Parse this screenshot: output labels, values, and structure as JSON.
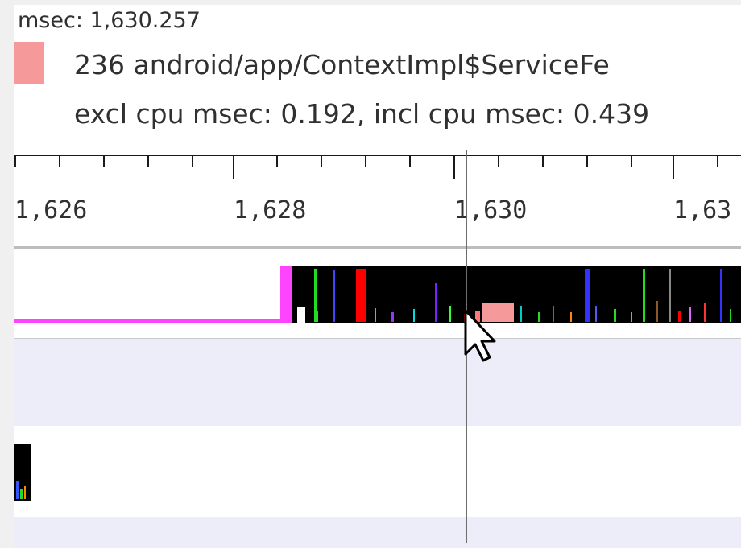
{
  "header": {
    "msec_text": "msec: 1,630.257",
    "method_text": "236 android/app/ContextImpl$ServiceFe",
    "cpu_text": "excl cpu msec: 0.192, incl cpu msec: 0.439",
    "swatch_color": "#f6999a"
  },
  "axis": {
    "labels": [
      "1,626",
      "1,628",
      "1,630",
      "1,63"
    ]
  },
  "colors": {
    "thread_idle": "#ff44ff",
    "block_bg": "#000000",
    "highlight": "#f6999a"
  },
  "icons": {
    "pointer": "mouse-pointer-icon"
  }
}
